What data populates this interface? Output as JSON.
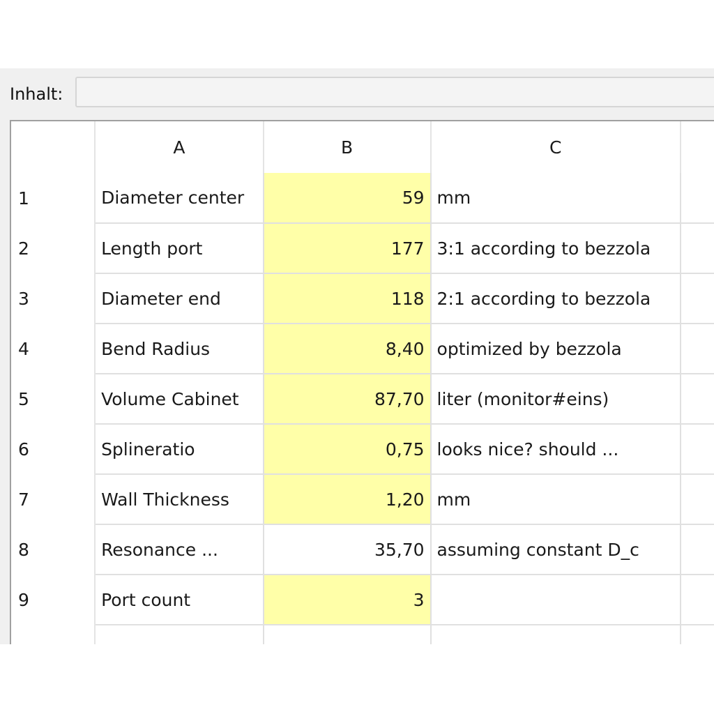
{
  "content_bar": {
    "label": "Inhalt:",
    "value": ""
  },
  "columns": [
    "A",
    "B",
    "C"
  ],
  "rows": [
    {
      "num": "1",
      "a": "Diameter center",
      "b": "59",
      "c": "mm",
      "highlight": true
    },
    {
      "num": "2",
      "a": "Length port",
      "b": "177",
      "c": "3:1 according to bezzola",
      "highlight": true
    },
    {
      "num": "3",
      "a": "Diameter end",
      "b": "118",
      "c": "2:1 according to bezzola",
      "highlight": true
    },
    {
      "num": "4",
      "a": "Bend Radius",
      "b": "8,40",
      "c": "optimized by bezzola",
      "highlight": true
    },
    {
      "num": "5",
      "a": "Volume Cabinet",
      "b": "87,70",
      "c": "liter (monitor#eins)",
      "highlight": true
    },
    {
      "num": "6",
      "a": "Splineratio",
      "b": "0,75",
      "c": "looks nice? should ...",
      "highlight": true
    },
    {
      "num": "7",
      "a": "Wall Thickness",
      "b": "1,20",
      "c": "mm",
      "highlight": true
    },
    {
      "num": "8",
      "a": "Resonance ...",
      "b": "35,70",
      "c": "assuming constant D_c",
      "highlight": false
    },
    {
      "num": "9",
      "a": "Port count",
      "b": "3",
      "c": "",
      "highlight": true
    }
  ],
  "colors": {
    "highlight": "#ffffa8",
    "gridline": "#e0e0e0",
    "frame": "#a0a0a0",
    "background": "#f0f0f0"
  }
}
